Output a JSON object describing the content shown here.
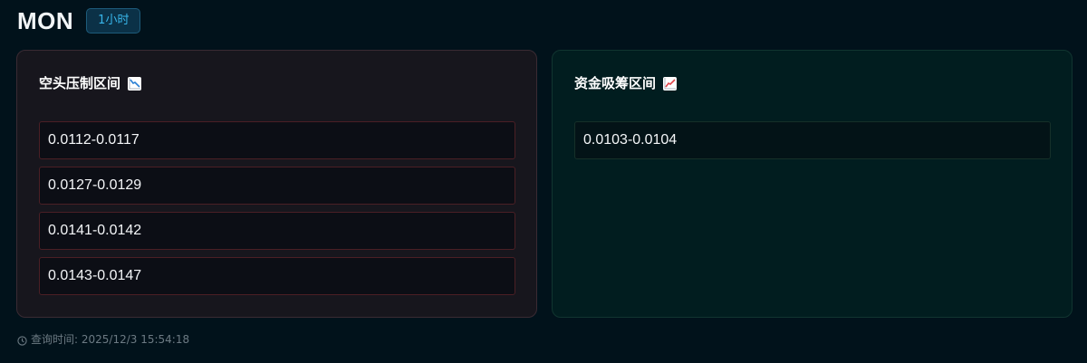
{
  "header": {
    "symbol": "MON",
    "timeframe": "1小时"
  },
  "resistance": {
    "title": "空头压制区间",
    "icon": "chart-decreasing-icon",
    "zones": [
      "0.0112-0.0117",
      "0.0127-0.0129",
      "0.0141-0.0142",
      "0.0143-0.0147"
    ]
  },
  "support": {
    "title": "资金吸筹区间",
    "icon": "chart-increasing-icon",
    "zones": [
      "0.0103-0.0104"
    ]
  },
  "footer": {
    "query_time": "查询时间: 2025/12/3 15:54:18",
    "icon": "clock-icon"
  },
  "colors": {
    "background": "#01121b",
    "accent": "#38b6ea",
    "bearish_border": "#4b1f25",
    "bullish_panel": "#011d1f"
  }
}
